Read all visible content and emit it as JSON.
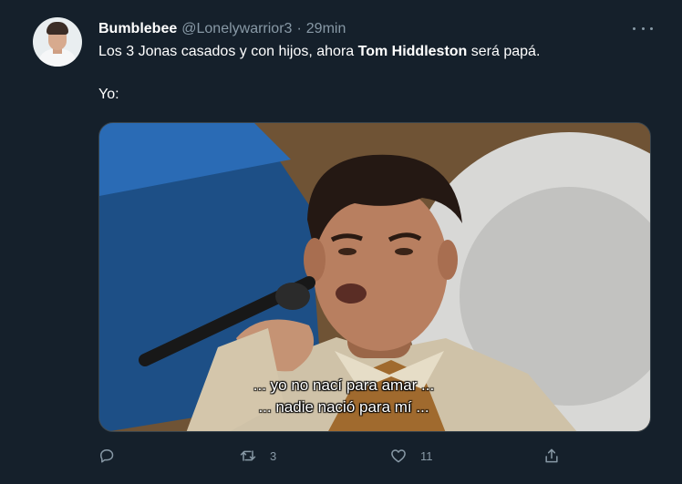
{
  "tweet": {
    "name": "Bumblebee",
    "handle": "@Lonelywarrior3",
    "separator": "·",
    "time": "29min",
    "text_before": "Los 3 Jonas casados y con hijos, ahora ",
    "text_bold": "Tom Hiddleston",
    "text_after": " será papá.",
    "line2": "Yo:",
    "subtitle_line1": "... yo no nací para amar ...",
    "subtitle_line2": "... nadie nació para mí ..."
  },
  "actions": {
    "reply_count": "",
    "retweet_count": "3",
    "like_count": "11"
  },
  "icons": {
    "more": "more-icon",
    "reply": "reply-icon",
    "retweet": "retweet-icon",
    "like": "like-icon",
    "share": "share-icon"
  },
  "colors": {
    "background": "#15202b",
    "secondary_text": "#8899a6",
    "border": "#38444d"
  }
}
